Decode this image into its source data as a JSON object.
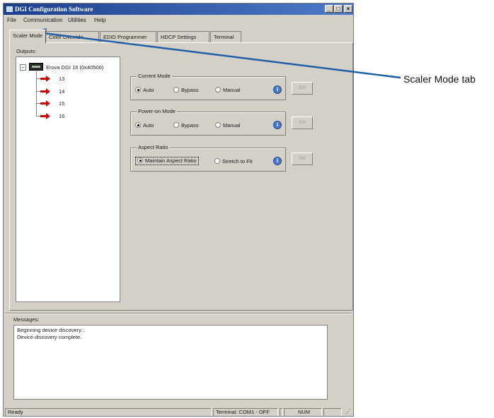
{
  "window": {
    "title": "DGI Configuration Software",
    "controls": {
      "minimize": "_",
      "restore": "□",
      "close": "×"
    }
  },
  "menu": [
    "File",
    "Communication",
    "Utilities",
    "Help"
  ],
  "tabs": [
    {
      "label": "Scaler Mode",
      "active": true
    },
    {
      "label": "Color Override",
      "active": false
    },
    {
      "label": "EDID Programmer",
      "active": false
    },
    {
      "label": "HDCP Settings",
      "active": false
    },
    {
      "label": "Terminal",
      "active": false
    }
  ],
  "outputs": {
    "label": "Outputs:",
    "expander": "−",
    "device_label": "Erova DGI 16 (0x40500)",
    "items": [
      "13",
      "14",
      "15",
      "16"
    ],
    "arrow_color": "#d40000"
  },
  "groups": [
    {
      "label": "Current Mode",
      "options": [
        {
          "label": "Auto",
          "selected": true
        },
        {
          "label": "Bypass",
          "selected": false
        },
        {
          "label": "Manual",
          "selected": false
        }
      ],
      "info_icon": "i",
      "set_label": "Set"
    },
    {
      "label": "Power-on Mode",
      "options": [
        {
          "label": "Auto",
          "selected": true
        },
        {
          "label": "Bypass",
          "selected": false
        },
        {
          "label": "Manual",
          "selected": false
        }
      ],
      "info_icon": "i",
      "set_label": "Set"
    },
    {
      "label": "Aspect Ratio",
      "options": [
        {
          "label": "Maintain Aspect Ratio",
          "selected": true
        },
        {
          "label": "Stretch to Fit",
          "selected": false
        }
      ],
      "info_icon": "i",
      "set_label": "Set"
    }
  ],
  "messages": {
    "label": "Messages:",
    "lines": [
      "Beginning device discovery...",
      "Device discovery complete."
    ]
  },
  "status": {
    "ready": "Ready",
    "terminal": "Terminal: COM1 - OFF",
    "num": "NUM"
  },
  "callout": {
    "label": "Scaler Mode tab",
    "color": "#1f5fa8"
  },
  "colors": {
    "titlebar": "#1c3f8c",
    "window_bg": "#d4d0c8"
  }
}
